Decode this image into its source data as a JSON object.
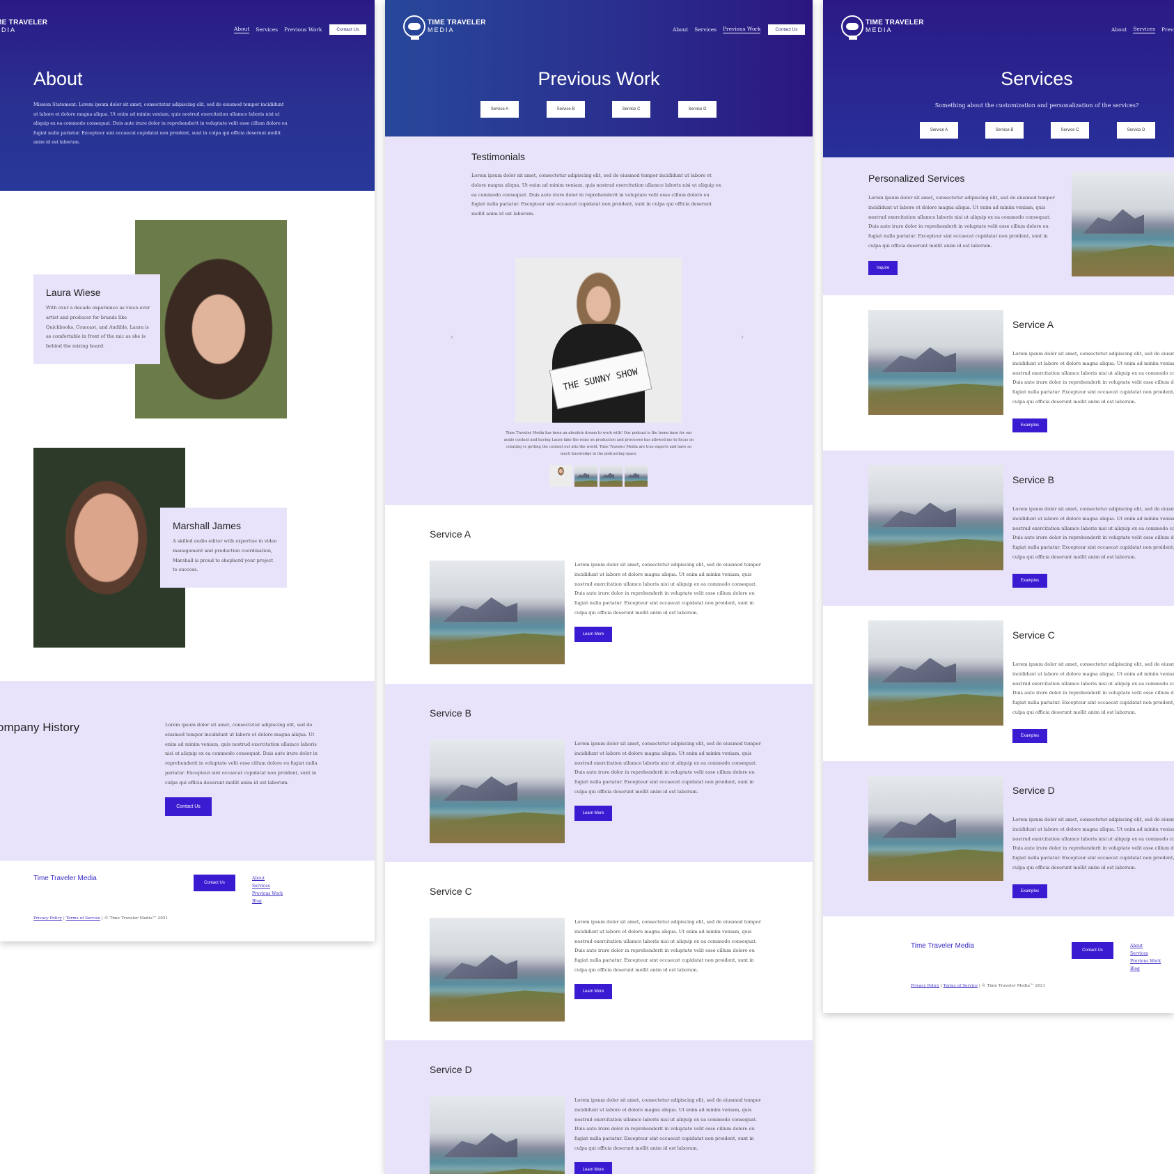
{
  "brand": {
    "line1": "TIME TRAVELER",
    "line2": "MEDIA",
    "about_line1": "ME TRAVELER",
    "about_line2": "EDIA"
  },
  "nav": {
    "about": "About",
    "services": "Services",
    "previous_work": "Previous Work",
    "contact": "Contact Us",
    "services_cut": "Previou"
  },
  "about_page": {
    "title": "About",
    "mission": "Mission Statement: Lorem ipsum dolor sit amet, consectetur adipiscing elit, sed do eiusmod tempor incididunt ut labore et dolore magna aliqua. Ut enim ad minim veniam, quis nostrud exercitation ullamco laboris nisi ut aliquip ex ea commodo consequat. Duis aute irure dolor in reprehenderit in voluptate velit esse cillum dolore eu fugiat nulla pariatur. Excepteur sint occaecat cupidatat non proident, sunt in culpa qui officia deserunt mollit anim id est laborum.",
    "team": [
      {
        "name": "Laura Wiese",
        "bio": "With over a decade experience as voice-over artist and producer for brands like Quickbooks, Comcast, and Audible, Laura is as comfortable in front of the mic as she is behind the mixing board."
      },
      {
        "name": "Marshall James",
        "bio": "A skilled audio editor with expertise in video management and production coordination, Marshall is proud to shepherd your project to success."
      }
    ],
    "history_title": "ompany History",
    "history_body": "Lorem ipsum dolor sit amet, consectetur adipiscing elit, sed do eiusmod tempor incididunt ut labore et dolore magna aliqua. Ut enim ad minim veniam, quis nostrud exercitation ullamco laboris nisi ut aliquip ex ea commodo consequat. Duis aute irure dolor in reprehenderit in voluptate velit esse cillum dolore eu fugiat nulla pariatur. Excepteur sint occaecat cupidatat non proident, sunt in culpa qui officia deserunt mollit anim id est laborum.",
    "history_button": "Contact Us"
  },
  "work_page": {
    "title": "Previous Work",
    "tabs": [
      "Service A",
      "Service B",
      "Service C",
      "Service D"
    ],
    "testimonials_title": "Testimonials",
    "testimonials_body": "Lorem ipsum dolor sit amet, consectetur adipiscing elit, sed do eiusmod tempor incididunt ut labore et dolore magna aliqua. Ut enim ad minim veniam, quis nostrud exercitation ullamco laboris nisi ut aliquip ex ea commodo consequat. Duis aute irure dolor in reprehenderit in voluptate velit esse cillum dolore eu fugiat nulla pariatur. Excepteur sint occaecat cupidatat non proident, sunt in culpa qui officia deserunt mollit anim id est laborum.",
    "sign_text": "THE SUNNY SHOW",
    "quote": "Time Traveler Media has been an absolute dream to work with! Our podcast is the home base for our audio content and having Laura take the reins on production and processes has allowed me to focus on creating vs getting the content out into the world. Time Traveler Media are true experts and have so much knowledge in the podcasting space.",
    "prev_arrow": "‹",
    "next_arrow": "›",
    "services": [
      {
        "title": "Service A",
        "button": "Learn More"
      },
      {
        "title": "Service B",
        "button": "Learn More"
      },
      {
        "title": "Service C",
        "button": "Learn More"
      },
      {
        "title": "Service D",
        "button": "Learn More"
      }
    ],
    "service_body": "Lorem ipsum dolor sit amet, consectetur adipiscing elit, sed do eiusmod tempor incididunt ut labore et dolore magna aliqua. Ut enim ad minim veniam, quis nostrud exercitation ullamco laboris nisi ut aliquip ex ea commodo consequat. Duis aute irure dolor in reprehenderit in voluptate velit esse cillum dolore eu fugiat nulla pariatur. Excepteur sint occaecat cupidatat non proident, sunt in culpa qui officia deserunt mollit anim id est laborum."
  },
  "services_page": {
    "title": "Services",
    "subtitle": "Something about the customization and personalization of the services?",
    "tabs": [
      "Service A",
      "Service B",
      "Service C",
      "Service D"
    ],
    "personalized_title": "Personalized Services",
    "personalized_body": "Lorem ipsum dolor sit amet, consectetur adipiscing elit, sed do eiusmod tempor incididunt ut labore et dolore magna aliqua. Ut enim ad minim veniam, quis nostrud exercitation ullamco laboris nisi ut aliquip ex ea commodo consequat. Duis aute irure dolor in reprehenderit in voluptate velit esse cillum dolore eu fugiat nulla pariatur. Excepteur sint occaecat cupidatat non proident, sunt in culpa qui officia deserunt mollit anim id est laborum.",
    "inquire": "Inquire",
    "services": [
      {
        "title": "Service A",
        "button": "Examples"
      },
      {
        "title": "Service B",
        "button": "Examples"
      },
      {
        "title": "Service C",
        "button": "Examples"
      },
      {
        "title": "Service D",
        "button": "Examples"
      }
    ],
    "service_body": "Lorem ipsum dolor sit amet, consectetur adipiscing elit, sed do eiusmod tempor incididunt ut labore et dolore magna aliqua. Ut enim ad minim veniam, quis nostrud exercitation ullamco laboris nisi ut aliquip ex ea commodo consequat. Duis aute irure dolor in reprehenderit in voluptate velit esse cillum dolore eu fugiat nulla pariatur. Excepteur sint occaecat cupidatat non proident, sunt in culpa qui officia deserunt mollit anim id est laborum."
  },
  "footer": {
    "brand": "Time Traveler Media",
    "contact": "Contact Us",
    "links": [
      "About",
      "Services",
      "Previous Work",
      "Blog"
    ],
    "privacy": "Privacy Policy",
    "terms": "Terms of Service",
    "copyright": "© Time Traveler Media™ 2021",
    "separator": "|"
  },
  "colors": {
    "accent": "#3a1bd2",
    "hero_dark": "#2b1a86",
    "lavender": "#e8e3fa"
  }
}
